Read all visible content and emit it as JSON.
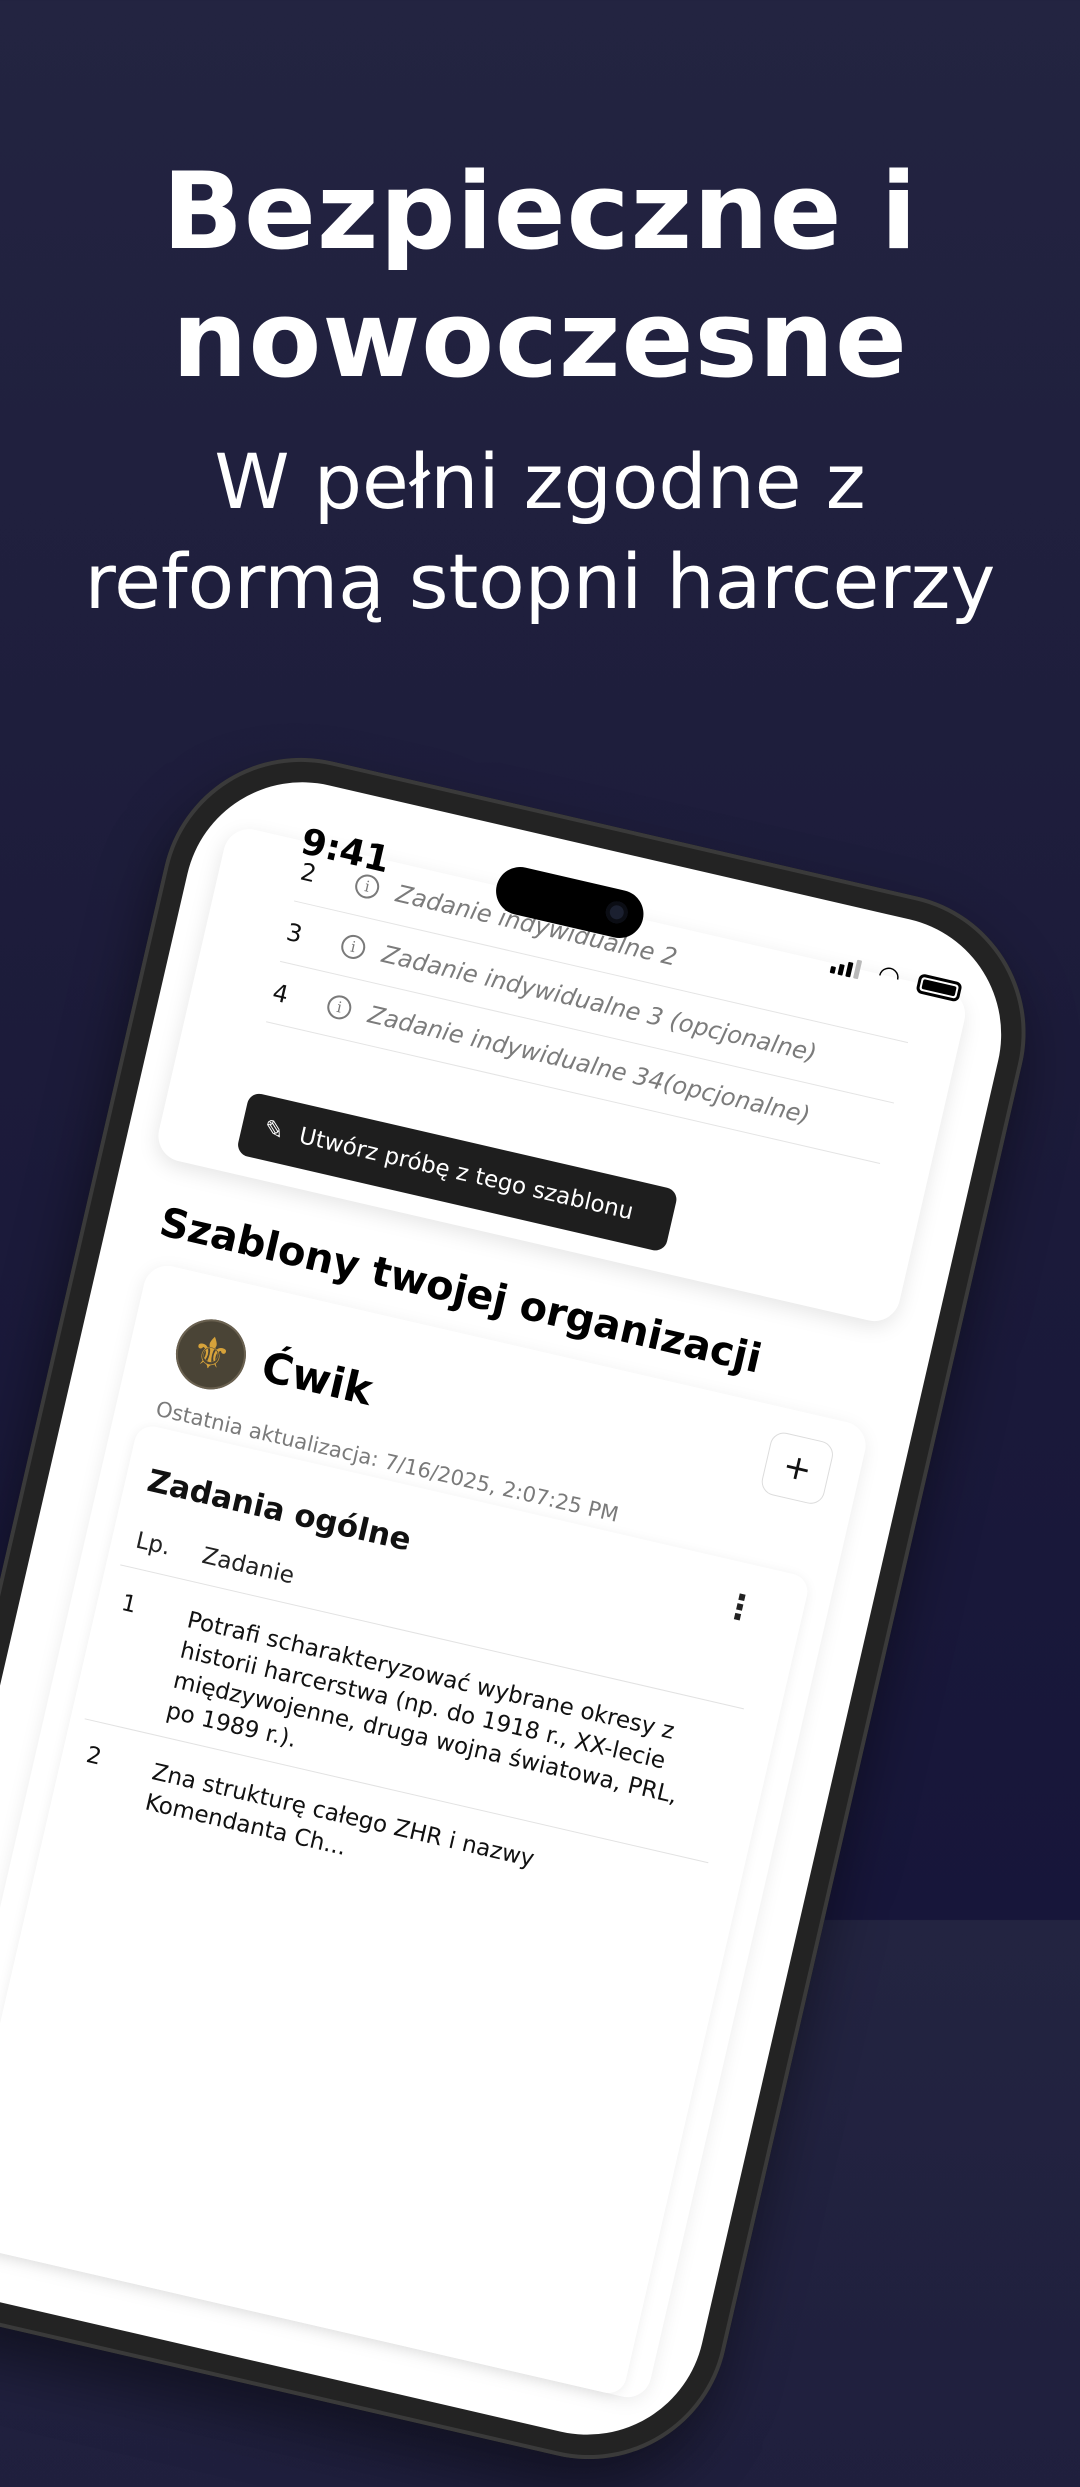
{
  "headline": {
    "title_line1": "Bezpieczne i",
    "title_line2": "nowoczesne",
    "subtitle_line1": "W pełni zgodne z",
    "subtitle_line2": "reformą stopni harcerzy"
  },
  "status_bar": {
    "time": "9:41"
  },
  "task_card": {
    "rows": [
      {
        "num": "2",
        "text": "Zadanie indywidualne 2"
      },
      {
        "num": "3",
        "text": "Zadanie indywidualne 3 (opcjonalne)"
      },
      {
        "num": "4",
        "text": "Zadanie indywidualne 34(opcjonalne)"
      }
    ],
    "create_button": "Utwórz próbę z tego szablonu"
  },
  "org_section": {
    "title": "Szablony twojej organizacji",
    "org_name": "Ćwik",
    "add_label": "+",
    "updated": "Ostatnia aktualizacja: 7/16/2025, 2:07:25 PM",
    "general_title": "Zadania ogólne",
    "col_lp": "Lp.",
    "col_task": "Zadanie",
    "tasks": [
      {
        "num": "1",
        "text": "Potrafi scharakteryzować wybrane okresy z historii harcerstwa (np. do 1918 r., XX-lecie międzywojenne, druga wojna światowa, PRL, po 1989 r.)."
      },
      {
        "num": "2",
        "text": "Zna strukturę całego ZHR i nazwy Komendanta Ch..."
      }
    ]
  },
  "icons": {
    "info": "info-icon",
    "pencil": "pencil-ruler-icon",
    "kebab": "more-vertical-icon",
    "fleur": "fleur-de-lis-icon"
  }
}
